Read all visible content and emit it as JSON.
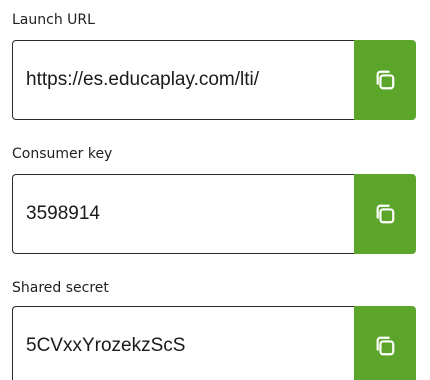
{
  "fields": [
    {
      "label": "Launch URL",
      "value": "https://es.educaplay.com/lti/",
      "copy_icon": "copy-icon"
    },
    {
      "label": "Consumer key",
      "value": "3598914",
      "copy_icon": "copy-icon"
    },
    {
      "label": "Shared secret",
      "value": "5CVxxYrozekzScS",
      "copy_icon": "copy-icon"
    }
  ],
  "colors": {
    "copy_button_bg": "#5ba52b",
    "input_border": "#2a2a2a",
    "text": "#1a1a1a"
  }
}
